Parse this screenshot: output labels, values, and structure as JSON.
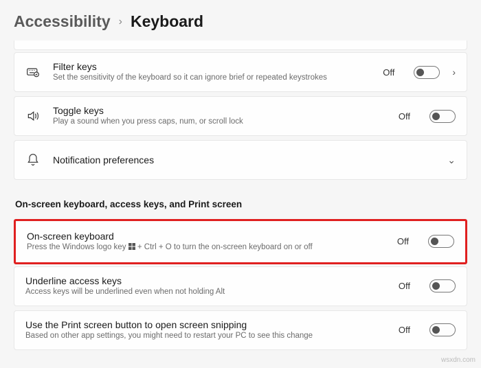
{
  "breadcrumb": {
    "parent": "Accessibility",
    "current": "Keyboard"
  },
  "items": {
    "filter_keys": {
      "title": "Filter keys",
      "desc": "Set the sensitivity of the keyboard so it can ignore brief or repeated keystrokes",
      "state": "Off"
    },
    "toggle_keys": {
      "title": "Toggle keys",
      "desc": "Play a sound when you press caps, num, or scroll lock",
      "state": "Off"
    },
    "notification_prefs": {
      "title": "Notification preferences"
    }
  },
  "section_title": "On-screen keyboard, access keys, and Print screen",
  "section": {
    "osk": {
      "title": "On-screen keyboard",
      "desc_before": "Press the Windows logo key ",
      "desc_after": " + Ctrl + O to turn the on-screen keyboard on or off",
      "state": "Off"
    },
    "underline": {
      "title": "Underline access keys",
      "desc": "Access keys will be underlined even when not holding Alt",
      "state": "Off"
    },
    "printscreen": {
      "title": "Use the Print screen button to open screen snipping",
      "desc": "Based on other app settings, you might need to restart your PC to see this change",
      "state": "Off"
    }
  },
  "watermark": "wsxdn.com"
}
